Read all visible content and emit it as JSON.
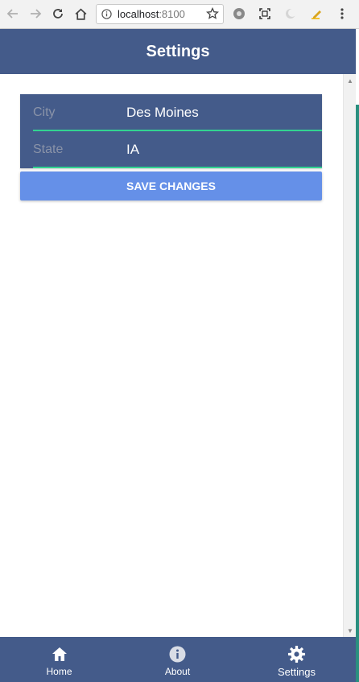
{
  "browser": {
    "url_host": "localhost",
    "url_port": ":8100"
  },
  "header": {
    "title": "Settings"
  },
  "form": {
    "fields": [
      {
        "label": "City",
        "value": "Des Moines"
      },
      {
        "label": "State",
        "value": "IA"
      }
    ],
    "save_label": "SAVE CHANGES"
  },
  "tabs": [
    {
      "label": "Home",
      "icon": "home-icon"
    },
    {
      "label": "About",
      "icon": "info-icon"
    },
    {
      "label": "Settings",
      "icon": "gear-icon",
      "active": true
    }
  ],
  "colors": {
    "primary": "#445b8a",
    "accent": "#32d391",
    "button": "#6590e8"
  }
}
